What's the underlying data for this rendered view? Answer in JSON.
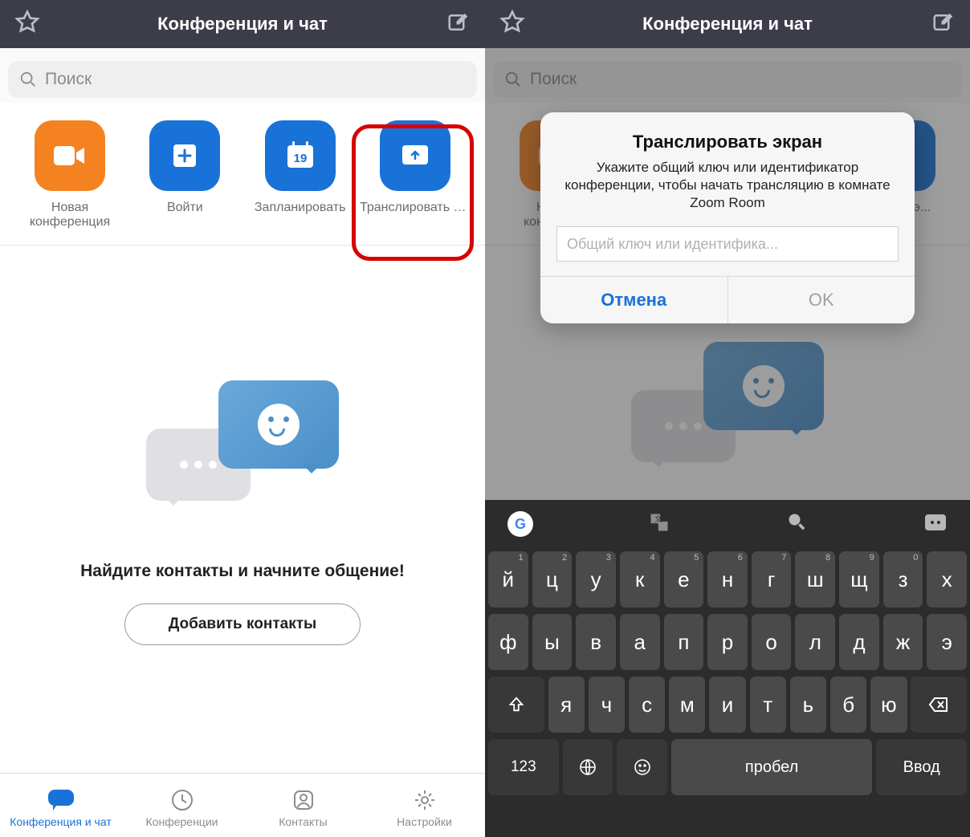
{
  "header": {
    "title": "Конференция и чат"
  },
  "search": {
    "placeholder": "Поиск"
  },
  "actions": {
    "new_meeting": "Новая\nконференция",
    "join": "Войти",
    "schedule": "Запланировать",
    "schedule_day": "19",
    "share": "Транслировать э..."
  },
  "empty": {
    "message": "Найдите контакты и начните общение!",
    "button": "Добавить контакты"
  },
  "tabs": {
    "chat": "Конференция и чат",
    "meetings": "Конференции",
    "contacts": "Контакты",
    "settings": "Настройки"
  },
  "right": {
    "actions_share_short": "ровать э...",
    "actions_new_short": "Новая\nконфере..."
  },
  "alert": {
    "title": "Транслировать экран",
    "text": "Укажите общий ключ или идентификатор конференции, чтобы начать трансляцию в комнате Zoom Room",
    "placeholder": "Общий ключ или идентифика...",
    "cancel": "Отмена",
    "ok": "OK"
  },
  "keyboard": {
    "row1": [
      {
        "c": "й",
        "n": "1"
      },
      {
        "c": "ц",
        "n": "2"
      },
      {
        "c": "у",
        "n": "3"
      },
      {
        "c": "к",
        "n": "4"
      },
      {
        "c": "е",
        "n": "5"
      },
      {
        "c": "н",
        "n": "6"
      },
      {
        "c": "г",
        "n": "7"
      },
      {
        "c": "ш",
        "n": "8"
      },
      {
        "c": "щ",
        "n": "9"
      },
      {
        "c": "з",
        "n": "0"
      },
      {
        "c": "х",
        "n": ""
      }
    ],
    "row2": [
      "ф",
      "ы",
      "в",
      "а",
      "п",
      "р",
      "о",
      "л",
      "д",
      "ж",
      "э"
    ],
    "row3": [
      "я",
      "ч",
      "с",
      "м",
      "и",
      "т",
      "ь",
      "б",
      "ю"
    ],
    "numeric": "123",
    "space": "пробел",
    "enter": "Ввод"
  }
}
